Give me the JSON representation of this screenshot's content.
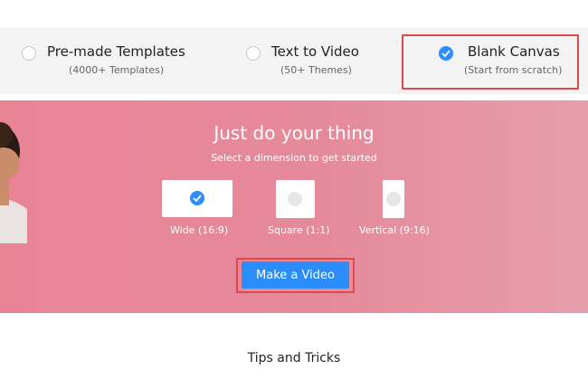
{
  "options": [
    {
      "title": "Pre-made Templates",
      "subtitle": "(4000+ Templates)",
      "selected": false
    },
    {
      "title": "Text to Video",
      "subtitle": "(50+ Themes)",
      "selected": false
    },
    {
      "title": "Blank Canvas",
      "subtitle": "(Start from scratch)",
      "selected": true
    }
  ],
  "banner": {
    "heading": "Just do your thing",
    "subheading": "Select a dimension to get started",
    "dimensions": [
      {
        "label": "Wide (16:9)",
        "selected": true
      },
      {
        "label": "Square (1:1)",
        "selected": false
      },
      {
        "label": "Vertical (9:16)",
        "selected": false
      }
    ],
    "cta_label": "Make a Video"
  },
  "footer": {
    "tips_heading": "Tips and Tricks"
  },
  "colors": {
    "accent": "#2d8cff",
    "banner": "#e98495",
    "highlight": "#e14848"
  }
}
